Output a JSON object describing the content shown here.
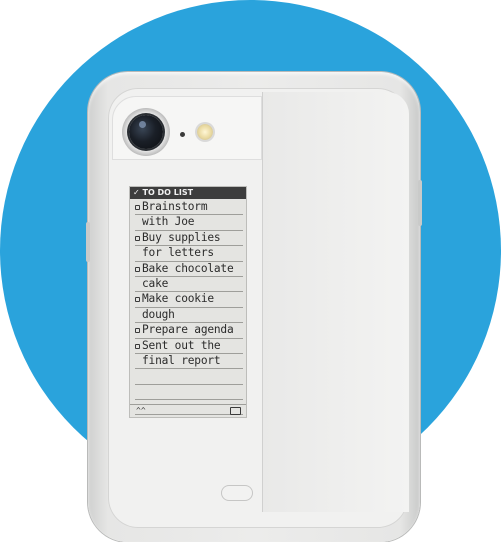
{
  "eink_screen": {
    "header": {
      "check": "✓",
      "title": "TO DO LIST"
    },
    "rows": [
      {
        "text": "Brainstorm",
        "bullet": true
      },
      {
        "text": "with Joe",
        "bullet": false
      },
      {
        "text": "Buy supplies",
        "bullet": true
      },
      {
        "text": "for letters",
        "bullet": false
      },
      {
        "text": "Bake chocolate",
        "bullet": true
      },
      {
        "text": "cake",
        "bullet": false
      },
      {
        "text": "Make cookie",
        "bullet": true
      },
      {
        "text": "dough",
        "bullet": false
      },
      {
        "text": "Prepare agenda",
        "bullet": true
      },
      {
        "text": "Sent out the",
        "bullet": true
      },
      {
        "text": "final report",
        "bullet": false
      },
      {
        "text": "",
        "bullet": false
      },
      {
        "text": "",
        "bullet": false
      },
      {
        "text": "",
        "bullet": false
      }
    ],
    "footer": {
      "left_icon": "chevron-up-down-icon",
      "left_glyph": "^^",
      "right_icon": "battery-icon"
    }
  },
  "colors": {
    "background_circle": "#2aa3dc",
    "case": "#e6e6e5",
    "eink_bg": "#e4e4e1",
    "eink_ink": "#2b2b2b"
  }
}
